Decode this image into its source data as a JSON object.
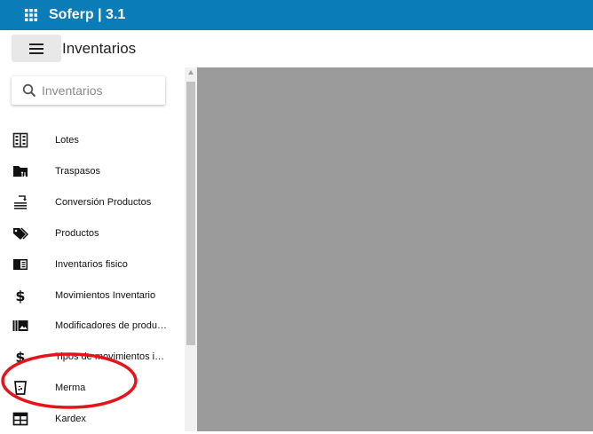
{
  "app": {
    "title": "Soferp | 3.1"
  },
  "header": {
    "page_title": "Inventarios"
  },
  "search": {
    "placeholder": "Inventarios"
  },
  "sidebar": {
    "items": [
      {
        "label": "Lotes",
        "icon": "lots-grid-icon"
      },
      {
        "label": "Traspasos",
        "icon": "folder-transfer-icon"
      },
      {
        "label": "Conversión Productos",
        "icon": "conversion-icon"
      },
      {
        "label": "Productos",
        "icon": "tags-icon"
      },
      {
        "label": "Inventarios fisico",
        "icon": "book-icon"
      },
      {
        "label": "Movimientos Inventario",
        "icon": "dollar-icon"
      },
      {
        "label": "Modificadores de productos",
        "icon": "photo-library-icon"
      },
      {
        "label": "Tipos de movimientos inventario",
        "icon": "dollar-icon"
      },
      {
        "label": "Merma",
        "icon": "trash-can-icon"
      },
      {
        "label": "Kardex",
        "icon": "table-icon"
      }
    ]
  },
  "colors": {
    "topbar": "#0a7cb8",
    "content_bg": "#9b9b9b",
    "annotation": "#e3141b"
  }
}
